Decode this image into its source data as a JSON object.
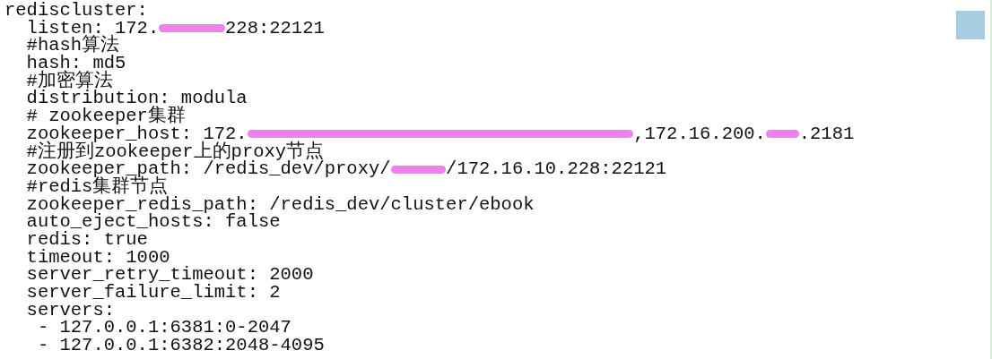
{
  "editor": {
    "lines": [
      {
        "segments": [
          {
            "kind": "text",
            "text": "rediscluster:"
          }
        ]
      },
      {
        "segments": [
          {
            "kind": "text",
            "text": "  listen: 172."
          },
          {
            "kind": "redaction"
          },
          {
            "kind": "text",
            "text": "228:22121"
          }
        ]
      },
      {
        "segments": [
          {
            "kind": "text",
            "text": "  #hash算法"
          }
        ]
      },
      {
        "segments": [
          {
            "kind": "text",
            "text": "  hash: md5"
          }
        ]
      },
      {
        "segments": [
          {
            "kind": "text",
            "text": "  #加密算法"
          }
        ]
      },
      {
        "segments": [
          {
            "kind": "text",
            "text": "  distribution: modula"
          }
        ]
      },
      {
        "segments": [
          {
            "kind": "text",
            "text": "  # zookeeper集群"
          }
        ]
      },
      {
        "segments": [
          {
            "kind": "text",
            "text": "  zookeeper_host: 172."
          },
          {
            "kind": "redaction"
          },
          {
            "kind": "text",
            "text": ",172.16.200."
          },
          {
            "kind": "redaction"
          },
          {
            "kind": "text",
            "text": ".2181"
          }
        ]
      },
      {
        "segments": [
          {
            "kind": "text",
            "text": "  #注册到zookeeper上的proxy节点"
          }
        ]
      },
      {
        "segments": [
          {
            "kind": "text",
            "text": "  zookeeper_path: /redis_dev/proxy/"
          },
          {
            "kind": "redaction"
          },
          {
            "kind": "text",
            "text": "/172.16.10.228:22121"
          }
        ]
      },
      {
        "segments": [
          {
            "kind": "text",
            "text": "  #redis集群节点"
          }
        ]
      },
      {
        "segments": [
          {
            "kind": "text",
            "text": "  zookeeper_redis_path: /redis_dev/cluster/ebook"
          }
        ]
      },
      {
        "segments": [
          {
            "kind": "text",
            "text": "  auto_eject_hosts: false"
          }
        ]
      },
      {
        "segments": [
          {
            "kind": "text",
            "text": "  redis: true"
          }
        ]
      },
      {
        "segments": [
          {
            "kind": "text",
            "text": "  timeout: 1000"
          }
        ]
      },
      {
        "segments": [
          {
            "kind": "text",
            "text": "  server_retry_timeout: 2000"
          }
        ]
      },
      {
        "segments": [
          {
            "kind": "text",
            "text": "  server_failure_limit: 2"
          }
        ]
      },
      {
        "segments": [
          {
            "kind": "text",
            "text": "  servers:"
          }
        ]
      },
      {
        "segments": [
          {
            "kind": "text",
            "text": "   - 127.0.0.1:6381:0-2047"
          }
        ]
      },
      {
        "segments": [
          {
            "kind": "text",
            "text": "   - 127.0.0.1:6382:2048-4095"
          }
        ]
      }
    ]
  }
}
